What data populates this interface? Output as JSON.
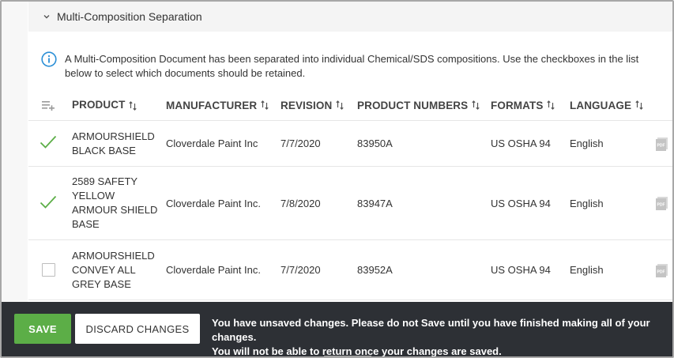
{
  "section": {
    "title": "Multi-Composition Separation"
  },
  "info": {
    "text": "A Multi-Composition Document has been separated into individual Chemical/SDS compositions. Use the checkboxes in the list below to select which documents should be retained."
  },
  "table": {
    "columns": {
      "product": "PRODUCT",
      "manufacturer": "MANUFACTURER",
      "revision": "REVISION",
      "product_numbers": "PRODUCT NUMBERS",
      "formats": "FORMATS",
      "language": "LANGUAGE"
    },
    "rows": [
      {
        "checked": true,
        "product": "ARMOURSHIELD BLACK BASE",
        "manufacturer": "Cloverdale Paint Inc",
        "revision": "7/7/2020",
        "product_numbers": "83950A",
        "formats": "US OSHA 94",
        "language": "English"
      },
      {
        "checked": true,
        "product": "2589 SAFETY YELLOW ARMOUR SHIELD BASE",
        "manufacturer": "Cloverdale Paint Inc.",
        "revision": "7/8/2020",
        "product_numbers": "83947A",
        "formats": "US OSHA 94",
        "language": "English"
      },
      {
        "checked": false,
        "product": "ARMOURSHIELD CONVEY ALL GREY BASE",
        "manufacturer": "Cloverdale Paint Inc.",
        "revision": "7/7/2020",
        "product_numbers": "83952A",
        "formats": "US OSHA 94",
        "language": "English"
      }
    ]
  },
  "footer": {
    "save_label": "SAVE",
    "discard_label": "DISCARD CHANGES",
    "message_line1": "You have unsaved changes. Please do not Save until you have finished making all of your changes.",
    "message_line2": "You will not be able to return once your changes are saved."
  },
  "colors": {
    "accent_green": "#5cae47",
    "check_green": "#5cae47",
    "info_blue": "#2b8fd6",
    "footer_bg": "#2d3035"
  },
  "icons": {
    "collapse": "chevron-down-icon",
    "info": "info-icon",
    "columns": "add-column-icon",
    "sort": "sort-icon",
    "checked": "checkmark-icon",
    "unchecked": "checkbox-icon",
    "document": "pdf-icon"
  }
}
